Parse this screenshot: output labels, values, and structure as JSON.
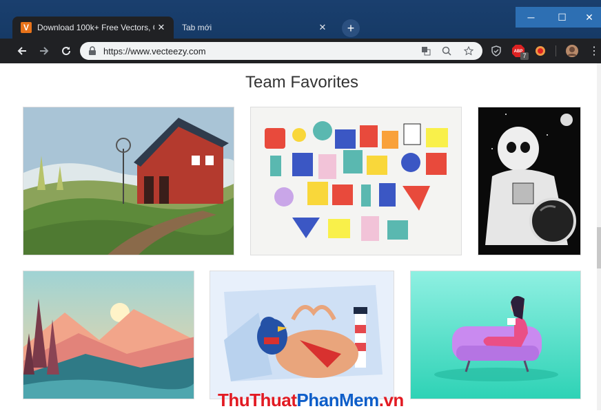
{
  "browser": {
    "tabs": [
      {
        "label": "Download 100k+ Free Vectors, C",
        "favicon": "V",
        "active": true
      },
      {
        "label": "Tab mới",
        "active": false
      }
    ],
    "new_tab_label": "+",
    "url": "https://www.vecteezy.com",
    "abp_badge": "7",
    "window_controls": {
      "minimize": "─",
      "maximize": "☐",
      "close": "✕"
    }
  },
  "page": {
    "heading": "Team Favorites",
    "images": [
      {
        "name": "farm-barn-illustration"
      },
      {
        "name": "alphabet-letters-illustration"
      },
      {
        "name": "skeleton-astronaut-illustration"
      },
      {
        "name": "mountain-lake-sunset-illustration"
      },
      {
        "name": "bird-and-deer-lighthouse-illustration"
      },
      {
        "name": "woman-reading-on-sofa-illustration"
      }
    ]
  },
  "watermark": {
    "part1": "ThuThuat",
    "part2": "PhanMem",
    "part3": ".vn"
  },
  "colors": {
    "accent": "#1a3f6e",
    "tab_active": "#202124",
    "watermark_red": "#e21b23",
    "watermark_blue": "#0e5ec9"
  }
}
